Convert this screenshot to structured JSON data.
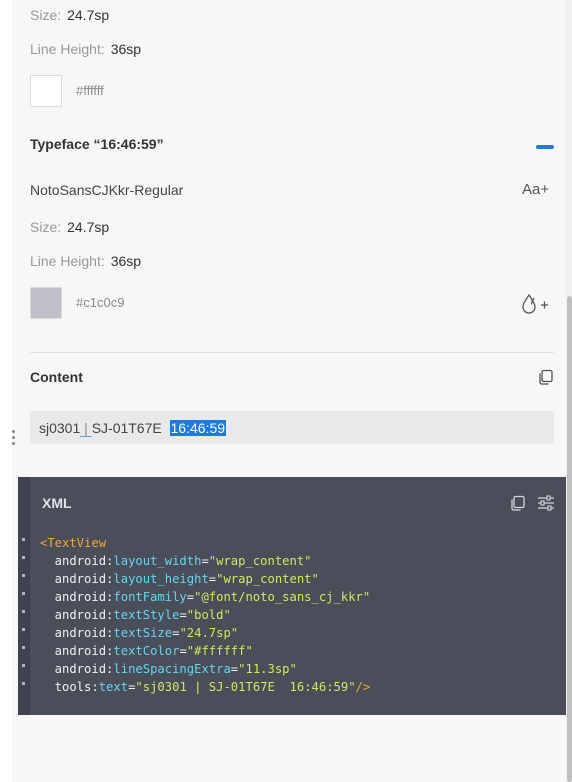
{
  "primary_font": {
    "size_label": "Size:",
    "size_value": "24.7sp",
    "line_height_label": "Line Height:",
    "line_height_value": "36sp",
    "color_hex": "#ffffff",
    "swatch_color": "#ffffff"
  },
  "typeface": {
    "title": "Typeface “16:46:59”",
    "font_name": "NotoSansCJKkr-Regular",
    "aa_icon_text": "Aa+",
    "size_label": "Size:",
    "size_value": "24.7sp",
    "line_height_label": "Line Height:",
    "line_height_value": "36sp",
    "color_hex": "#c1c0c9",
    "swatch_color": "#c1c0c9",
    "collapse_color": "#1f7ae0"
  },
  "content": {
    "title": "Content",
    "text_before": "sj0301",
    "separator": " | ",
    "text_middle": "SJ-01T67E  ",
    "highlighted": "16:46:59"
  },
  "xml": {
    "title": "XML",
    "lines": [
      [
        {
          "c": "t-tag",
          "t": "<TextView"
        }
      ],
      [
        {
          "c": "t-ns",
          "t": "  android"
        },
        {
          "c": "t-ns",
          "t": ":"
        },
        {
          "c": "t-key",
          "t": "layout_width"
        },
        {
          "c": "t-ns",
          "t": "="
        },
        {
          "c": "t-str",
          "t": "\"wrap_content\""
        }
      ],
      [
        {
          "c": "t-ns",
          "t": "  android"
        },
        {
          "c": "t-ns",
          "t": ":"
        },
        {
          "c": "t-key",
          "t": "layout_height"
        },
        {
          "c": "t-ns",
          "t": "="
        },
        {
          "c": "t-str",
          "t": "\"wrap_content\""
        }
      ],
      [
        {
          "c": "t-ns",
          "t": "  android"
        },
        {
          "c": "t-ns",
          "t": ":"
        },
        {
          "c": "t-key",
          "t": "fontFamily"
        },
        {
          "c": "t-ns",
          "t": "="
        },
        {
          "c": "t-str",
          "t": "\"@font/noto_sans_cj_kkr\""
        }
      ],
      [
        {
          "c": "t-ns",
          "t": "  android"
        },
        {
          "c": "t-ns",
          "t": ":"
        },
        {
          "c": "t-key",
          "t": "textStyle"
        },
        {
          "c": "t-ns",
          "t": "="
        },
        {
          "c": "t-str",
          "t": "\"bold\""
        }
      ],
      [
        {
          "c": "t-ns",
          "t": "  android"
        },
        {
          "c": "t-ns",
          "t": ":"
        },
        {
          "c": "t-key",
          "t": "textSize"
        },
        {
          "c": "t-ns",
          "t": "="
        },
        {
          "c": "t-str",
          "t": "\"24.7sp\""
        }
      ],
      [
        {
          "c": "t-ns",
          "t": "  android"
        },
        {
          "c": "t-ns",
          "t": ":"
        },
        {
          "c": "t-key",
          "t": "textColor"
        },
        {
          "c": "t-ns",
          "t": "="
        },
        {
          "c": "t-str",
          "t": "\"#ffffff\""
        }
      ],
      [
        {
          "c": "t-ns",
          "t": "  android"
        },
        {
          "c": "t-ns",
          "t": ":"
        },
        {
          "c": "t-key",
          "t": "lineSpacingExtra"
        },
        {
          "c": "t-ns",
          "t": "="
        },
        {
          "c": "t-str",
          "t": "\"11.3sp\""
        }
      ],
      [
        {
          "c": "t-ns",
          "t": "  tools"
        },
        {
          "c": "t-ns",
          "t": ":"
        },
        {
          "c": "t-key",
          "t": "text"
        },
        {
          "c": "t-ns",
          "t": "="
        },
        {
          "c": "t-str",
          "t": "\"sj0301 | SJ-01T67E  16:46:59\""
        },
        {
          "c": "t-tag",
          "t": "/>"
        }
      ]
    ]
  }
}
